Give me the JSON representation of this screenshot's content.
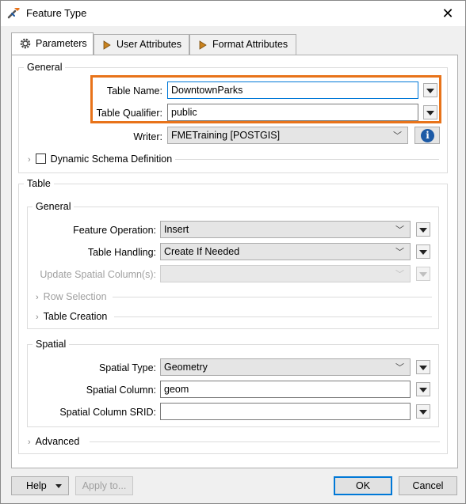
{
  "window": {
    "title": "Feature Type",
    "close_glyph": "✕"
  },
  "tabs": [
    {
      "label": "Parameters",
      "icon": "gear-icon"
    },
    {
      "label": "User Attributes",
      "icon": "arrow-right-icon"
    },
    {
      "label": "Format Attributes",
      "icon": "arrow-right-icon"
    }
  ],
  "general": {
    "label": "General",
    "table_name": {
      "label": "Table Name:",
      "value": "DowntownParks"
    },
    "table_qualifier": {
      "label": "Table Qualifier:",
      "value": "public"
    },
    "writer": {
      "label": "Writer:",
      "value": "FMETraining [POSTGIS]"
    },
    "dynamic_schema": {
      "label": "Dynamic Schema Definition",
      "checked": false
    }
  },
  "table": {
    "label": "Table",
    "general": {
      "label": "General",
      "feature_operation": {
        "label": "Feature Operation:",
        "value": "Insert"
      },
      "table_handling": {
        "label": "Table Handling:",
        "value": "Create If Needed"
      },
      "update_spatial": {
        "label": "Update Spatial Column(s):",
        "value": ""
      },
      "row_selection": "Row Selection",
      "table_creation": "Table Creation"
    },
    "spatial": {
      "label": "Spatial",
      "spatial_type": {
        "label": "Spatial Type:",
        "value": "Geometry"
      },
      "spatial_column": {
        "label": "Spatial Column:",
        "value": "geom"
      },
      "spatial_srid": {
        "label": "Spatial Column SRID:",
        "value": ""
      }
    }
  },
  "advanced": "Advanced",
  "footer": {
    "help": "Help",
    "apply": "Apply to...",
    "ok": "OK",
    "cancel": "Cancel"
  },
  "colors": {
    "highlight": "#e8731a",
    "info": "#1c5aa6",
    "focus": "#0078d7"
  }
}
